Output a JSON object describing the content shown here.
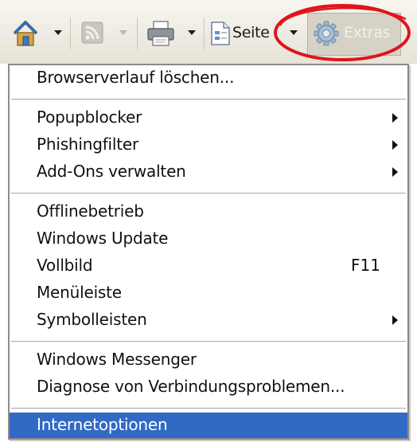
{
  "toolbar": {
    "items": [
      {
        "name": "home",
        "icon": "home-icon",
        "dropdown": true
      },
      {
        "name": "feeds",
        "icon": "rss-feed-icon",
        "dropdown": true,
        "disabled": true
      },
      {
        "name": "print",
        "icon": "printer-icon",
        "dropdown": true
      },
      {
        "name": "page",
        "icon": "page-icon",
        "label": "Seite",
        "dropdown": true
      },
      {
        "name": "extras",
        "icon": "gear-icon",
        "label": "Extras",
        "state": "pressed"
      }
    ],
    "seite_label": "Seite",
    "extras_label": "Extras",
    "annotation_color": "#e0141c"
  },
  "menu": {
    "items": [
      {
        "label": "Browserverlauf löschen..."
      },
      {
        "label": "Popupblocker",
        "submenu": true
      },
      {
        "label": "Phishingfilter",
        "submenu": true
      },
      {
        "label": "Add-Ons verwalten",
        "submenu": true
      },
      {
        "label": "Offlinebetrieb"
      },
      {
        "label": "Windows Update"
      },
      {
        "label": "Vollbild",
        "shortcut": "F11"
      },
      {
        "label": "Menüleiste"
      },
      {
        "label": "Symbolleisten",
        "submenu": true
      },
      {
        "label": "Windows Messenger"
      },
      {
        "label": "Diagnose von Verbindungsproblemen..."
      },
      {
        "label": "Internetoptionen",
        "selected": true
      }
    ],
    "selection_color": "#316ac5"
  }
}
